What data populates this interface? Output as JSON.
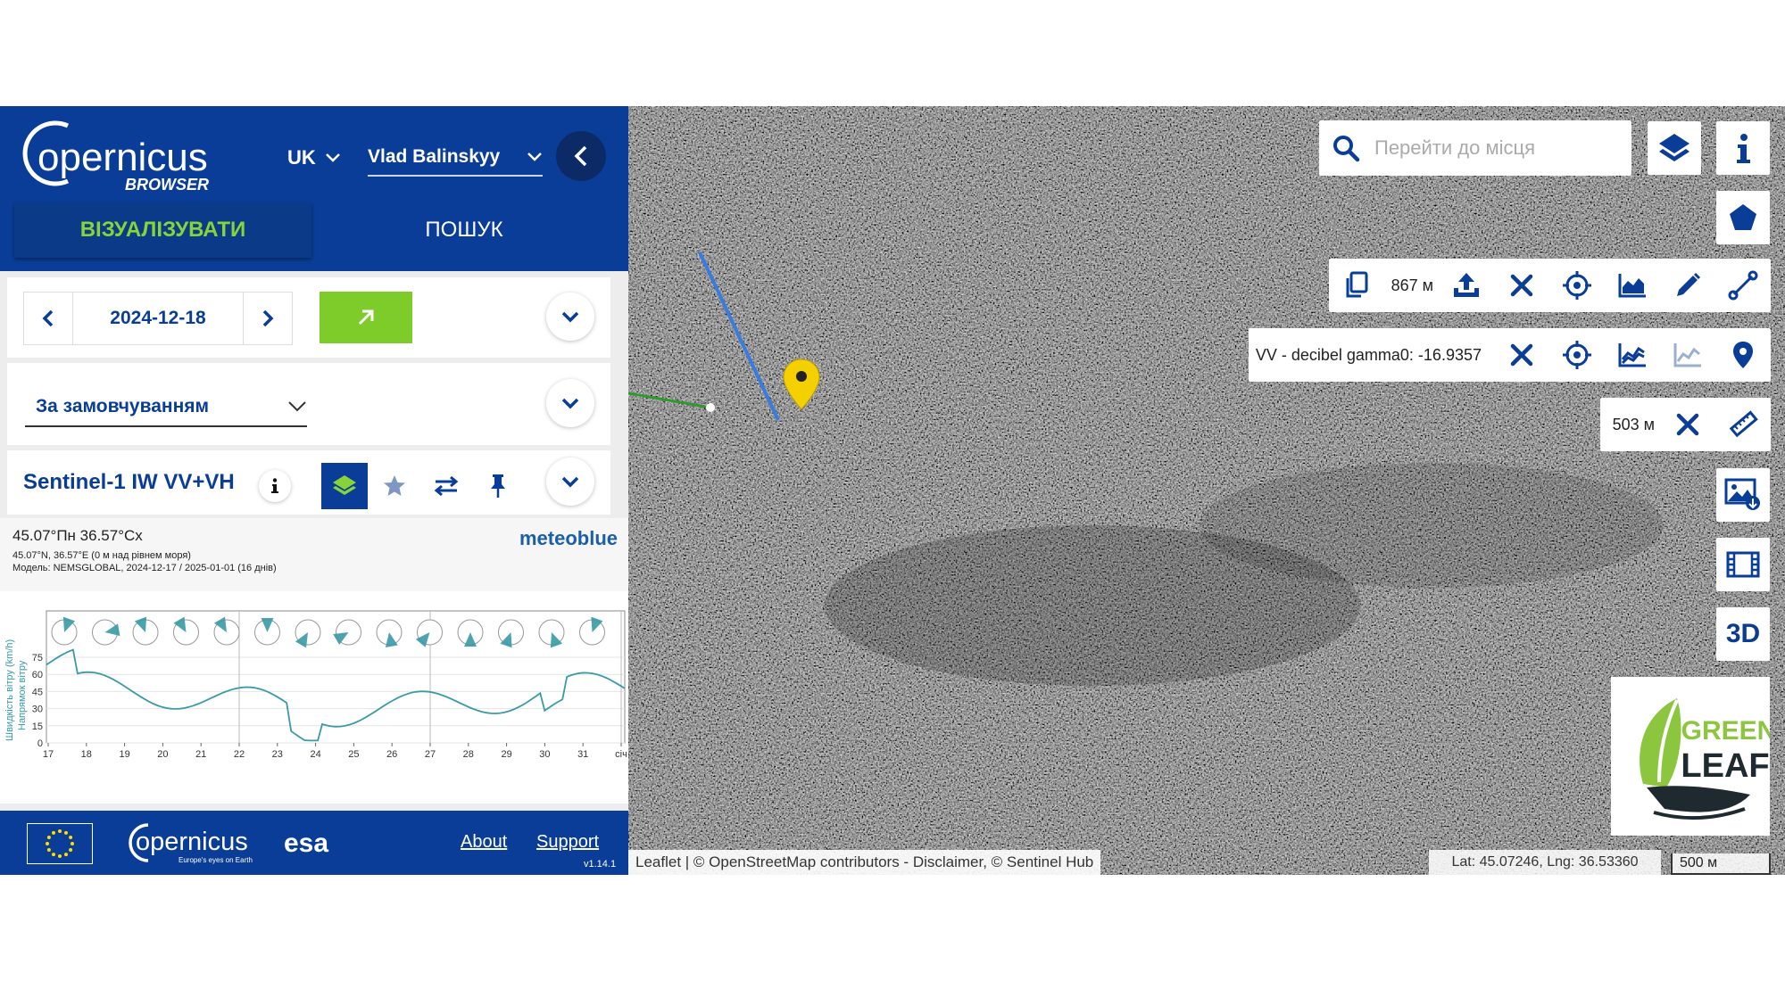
{
  "sidebar": {
    "brand": {
      "name": "opernicus",
      "sub": "BROWSER"
    },
    "lang": "UK",
    "user": "Vlad Balinskyy",
    "tabs": {
      "visualize": "ВІЗУАЛІЗУВАТИ",
      "search": "ПОШУК"
    },
    "date": "2024-12-18",
    "theme": "За замовчуванням",
    "layer_name": "Sentinel-1 IW VV+VH"
  },
  "weather": {
    "title": "45.07°Пн 36.57°Сх",
    "subtitle": "45.07°N, 36.57°E (0 м над рівнем моря)",
    "model": "Модель: NEMSGLOBAL, 2024-12-17 / 2025-01-01 (16 днів)",
    "brand": "meteoblue",
    "y_label_speed": "Швидкість вітру (km/h)",
    "y_label_dir": "Напрямок вітру",
    "y_ticks": [
      "75",
      "60",
      "45",
      "30",
      "15",
      "0"
    ],
    "x_ticks": [
      "17",
      "18",
      "19",
      "20",
      "21",
      "22",
      "23",
      "24",
      "25",
      "26",
      "27",
      "28",
      "29",
      "30",
      "31",
      "січ"
    ]
  },
  "footer": {
    "logo": "opernicus",
    "logo_tagline": "Europe's eyes on Earth",
    "esa": "esa",
    "about": "About",
    "support": "Support",
    "version": "v1.14.1"
  },
  "map": {
    "search_placeholder": "Перейти до місця",
    "three_d": "3D",
    "distance_label": "867 м",
    "poi_value": "VV - decibel gamma0: -16.9357",
    "measure_label": "503 м",
    "logo_line1": "GREEN",
    "logo_line2": "LEAF",
    "attribution": "Leaflet | © OpenStreetMap contributors - Disclaimer, © Sentinel Hub",
    "coords": "Lat: 45.07246, Lng: 36.53360",
    "scale": "500 м"
  },
  "colors": {
    "brand_blue": "#0a3d97",
    "accent_green": "#7dcc2a",
    "pin_yellow": "#f5d000",
    "line_blue": "#3a7be0",
    "line_green": "#2e9a2e"
  },
  "icons": [
    "search-icon",
    "layers-icon",
    "info-icon",
    "pentagon-icon",
    "copy-icon",
    "upload-icon",
    "close-icon",
    "crosshair-icon",
    "area-chart-icon",
    "pencil-icon",
    "line-icon",
    "chart-icon",
    "trend-icon",
    "location-pin-icon",
    "ruler-icon",
    "image-download-icon",
    "film-icon",
    "chevron-down-icon",
    "chevron-left-icon",
    "chevron-right-icon",
    "external-link-icon",
    "star-icon",
    "swap-icon",
    "pin-icon"
  ]
}
